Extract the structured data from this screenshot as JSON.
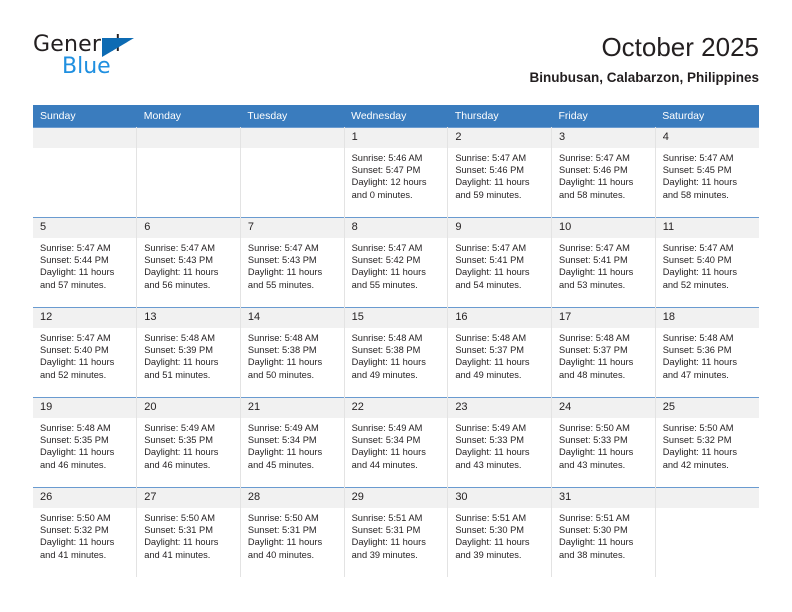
{
  "brand": {
    "name_dark": "General",
    "name_light": "Blue",
    "triangle_color": "#0d6bb3",
    "light_color": "#1f8fe0"
  },
  "header": {
    "title": "October 2025",
    "subtitle": "Binubusan, Calabarzon, Philippines"
  },
  "theme": {
    "header_row_bg": "#3a7cbe",
    "header_row_text": "#ffffff",
    "daynum_bg": "#f1f1f1",
    "cell_border": "#6a9bd0"
  },
  "weekdays": [
    "Sunday",
    "Monday",
    "Tuesday",
    "Wednesday",
    "Thursday",
    "Friday",
    "Saturday"
  ],
  "weeks": [
    [
      {
        "day": "",
        "sunrise": "",
        "sunset": "",
        "daylight1": "",
        "daylight2": ""
      },
      {
        "day": "",
        "sunrise": "",
        "sunset": "",
        "daylight1": "",
        "daylight2": ""
      },
      {
        "day": "",
        "sunrise": "",
        "sunset": "",
        "daylight1": "",
        "daylight2": ""
      },
      {
        "day": "1",
        "sunrise": "Sunrise: 5:46 AM",
        "sunset": "Sunset: 5:47 PM",
        "daylight1": "Daylight: 12 hours",
        "daylight2": "and 0 minutes."
      },
      {
        "day": "2",
        "sunrise": "Sunrise: 5:47 AM",
        "sunset": "Sunset: 5:46 PM",
        "daylight1": "Daylight: 11 hours",
        "daylight2": "and 59 minutes."
      },
      {
        "day": "3",
        "sunrise": "Sunrise: 5:47 AM",
        "sunset": "Sunset: 5:46 PM",
        "daylight1": "Daylight: 11 hours",
        "daylight2": "and 58 minutes."
      },
      {
        "day": "4",
        "sunrise": "Sunrise: 5:47 AM",
        "sunset": "Sunset: 5:45 PM",
        "daylight1": "Daylight: 11 hours",
        "daylight2": "and 58 minutes."
      }
    ],
    [
      {
        "day": "5",
        "sunrise": "Sunrise: 5:47 AM",
        "sunset": "Sunset: 5:44 PM",
        "daylight1": "Daylight: 11 hours",
        "daylight2": "and 57 minutes."
      },
      {
        "day": "6",
        "sunrise": "Sunrise: 5:47 AM",
        "sunset": "Sunset: 5:43 PM",
        "daylight1": "Daylight: 11 hours",
        "daylight2": "and 56 minutes."
      },
      {
        "day": "7",
        "sunrise": "Sunrise: 5:47 AM",
        "sunset": "Sunset: 5:43 PM",
        "daylight1": "Daylight: 11 hours",
        "daylight2": "and 55 minutes."
      },
      {
        "day": "8",
        "sunrise": "Sunrise: 5:47 AM",
        "sunset": "Sunset: 5:42 PM",
        "daylight1": "Daylight: 11 hours",
        "daylight2": "and 55 minutes."
      },
      {
        "day": "9",
        "sunrise": "Sunrise: 5:47 AM",
        "sunset": "Sunset: 5:41 PM",
        "daylight1": "Daylight: 11 hours",
        "daylight2": "and 54 minutes."
      },
      {
        "day": "10",
        "sunrise": "Sunrise: 5:47 AM",
        "sunset": "Sunset: 5:41 PM",
        "daylight1": "Daylight: 11 hours",
        "daylight2": "and 53 minutes."
      },
      {
        "day": "11",
        "sunrise": "Sunrise: 5:47 AM",
        "sunset": "Sunset: 5:40 PM",
        "daylight1": "Daylight: 11 hours",
        "daylight2": "and 52 minutes."
      }
    ],
    [
      {
        "day": "12",
        "sunrise": "Sunrise: 5:47 AM",
        "sunset": "Sunset: 5:40 PM",
        "daylight1": "Daylight: 11 hours",
        "daylight2": "and 52 minutes."
      },
      {
        "day": "13",
        "sunrise": "Sunrise: 5:48 AM",
        "sunset": "Sunset: 5:39 PM",
        "daylight1": "Daylight: 11 hours",
        "daylight2": "and 51 minutes."
      },
      {
        "day": "14",
        "sunrise": "Sunrise: 5:48 AM",
        "sunset": "Sunset: 5:38 PM",
        "daylight1": "Daylight: 11 hours",
        "daylight2": "and 50 minutes."
      },
      {
        "day": "15",
        "sunrise": "Sunrise: 5:48 AM",
        "sunset": "Sunset: 5:38 PM",
        "daylight1": "Daylight: 11 hours",
        "daylight2": "and 49 minutes."
      },
      {
        "day": "16",
        "sunrise": "Sunrise: 5:48 AM",
        "sunset": "Sunset: 5:37 PM",
        "daylight1": "Daylight: 11 hours",
        "daylight2": "and 49 minutes."
      },
      {
        "day": "17",
        "sunrise": "Sunrise: 5:48 AM",
        "sunset": "Sunset: 5:37 PM",
        "daylight1": "Daylight: 11 hours",
        "daylight2": "and 48 minutes."
      },
      {
        "day": "18",
        "sunrise": "Sunrise: 5:48 AM",
        "sunset": "Sunset: 5:36 PM",
        "daylight1": "Daylight: 11 hours",
        "daylight2": "and 47 minutes."
      }
    ],
    [
      {
        "day": "19",
        "sunrise": "Sunrise: 5:48 AM",
        "sunset": "Sunset: 5:35 PM",
        "daylight1": "Daylight: 11 hours",
        "daylight2": "and 46 minutes."
      },
      {
        "day": "20",
        "sunrise": "Sunrise: 5:49 AM",
        "sunset": "Sunset: 5:35 PM",
        "daylight1": "Daylight: 11 hours",
        "daylight2": "and 46 minutes."
      },
      {
        "day": "21",
        "sunrise": "Sunrise: 5:49 AM",
        "sunset": "Sunset: 5:34 PM",
        "daylight1": "Daylight: 11 hours",
        "daylight2": "and 45 minutes."
      },
      {
        "day": "22",
        "sunrise": "Sunrise: 5:49 AM",
        "sunset": "Sunset: 5:34 PM",
        "daylight1": "Daylight: 11 hours",
        "daylight2": "and 44 minutes."
      },
      {
        "day": "23",
        "sunrise": "Sunrise: 5:49 AM",
        "sunset": "Sunset: 5:33 PM",
        "daylight1": "Daylight: 11 hours",
        "daylight2": "and 43 minutes."
      },
      {
        "day": "24",
        "sunrise": "Sunrise: 5:50 AM",
        "sunset": "Sunset: 5:33 PM",
        "daylight1": "Daylight: 11 hours",
        "daylight2": "and 43 minutes."
      },
      {
        "day": "25",
        "sunrise": "Sunrise: 5:50 AM",
        "sunset": "Sunset: 5:32 PM",
        "daylight1": "Daylight: 11 hours",
        "daylight2": "and 42 minutes."
      }
    ],
    [
      {
        "day": "26",
        "sunrise": "Sunrise: 5:50 AM",
        "sunset": "Sunset: 5:32 PM",
        "daylight1": "Daylight: 11 hours",
        "daylight2": "and 41 minutes."
      },
      {
        "day": "27",
        "sunrise": "Sunrise: 5:50 AM",
        "sunset": "Sunset: 5:31 PM",
        "daylight1": "Daylight: 11 hours",
        "daylight2": "and 41 minutes."
      },
      {
        "day": "28",
        "sunrise": "Sunrise: 5:50 AM",
        "sunset": "Sunset: 5:31 PM",
        "daylight1": "Daylight: 11 hours",
        "daylight2": "and 40 minutes."
      },
      {
        "day": "29",
        "sunrise": "Sunrise: 5:51 AM",
        "sunset": "Sunset: 5:31 PM",
        "daylight1": "Daylight: 11 hours",
        "daylight2": "and 39 minutes."
      },
      {
        "day": "30",
        "sunrise": "Sunrise: 5:51 AM",
        "sunset": "Sunset: 5:30 PM",
        "daylight1": "Daylight: 11 hours",
        "daylight2": "and 39 minutes."
      },
      {
        "day": "31",
        "sunrise": "Sunrise: 5:51 AM",
        "sunset": "Sunset: 5:30 PM",
        "daylight1": "Daylight: 11 hours",
        "daylight2": "and 38 minutes."
      },
      {
        "day": "",
        "sunrise": "",
        "sunset": "",
        "daylight1": "",
        "daylight2": ""
      }
    ]
  ]
}
